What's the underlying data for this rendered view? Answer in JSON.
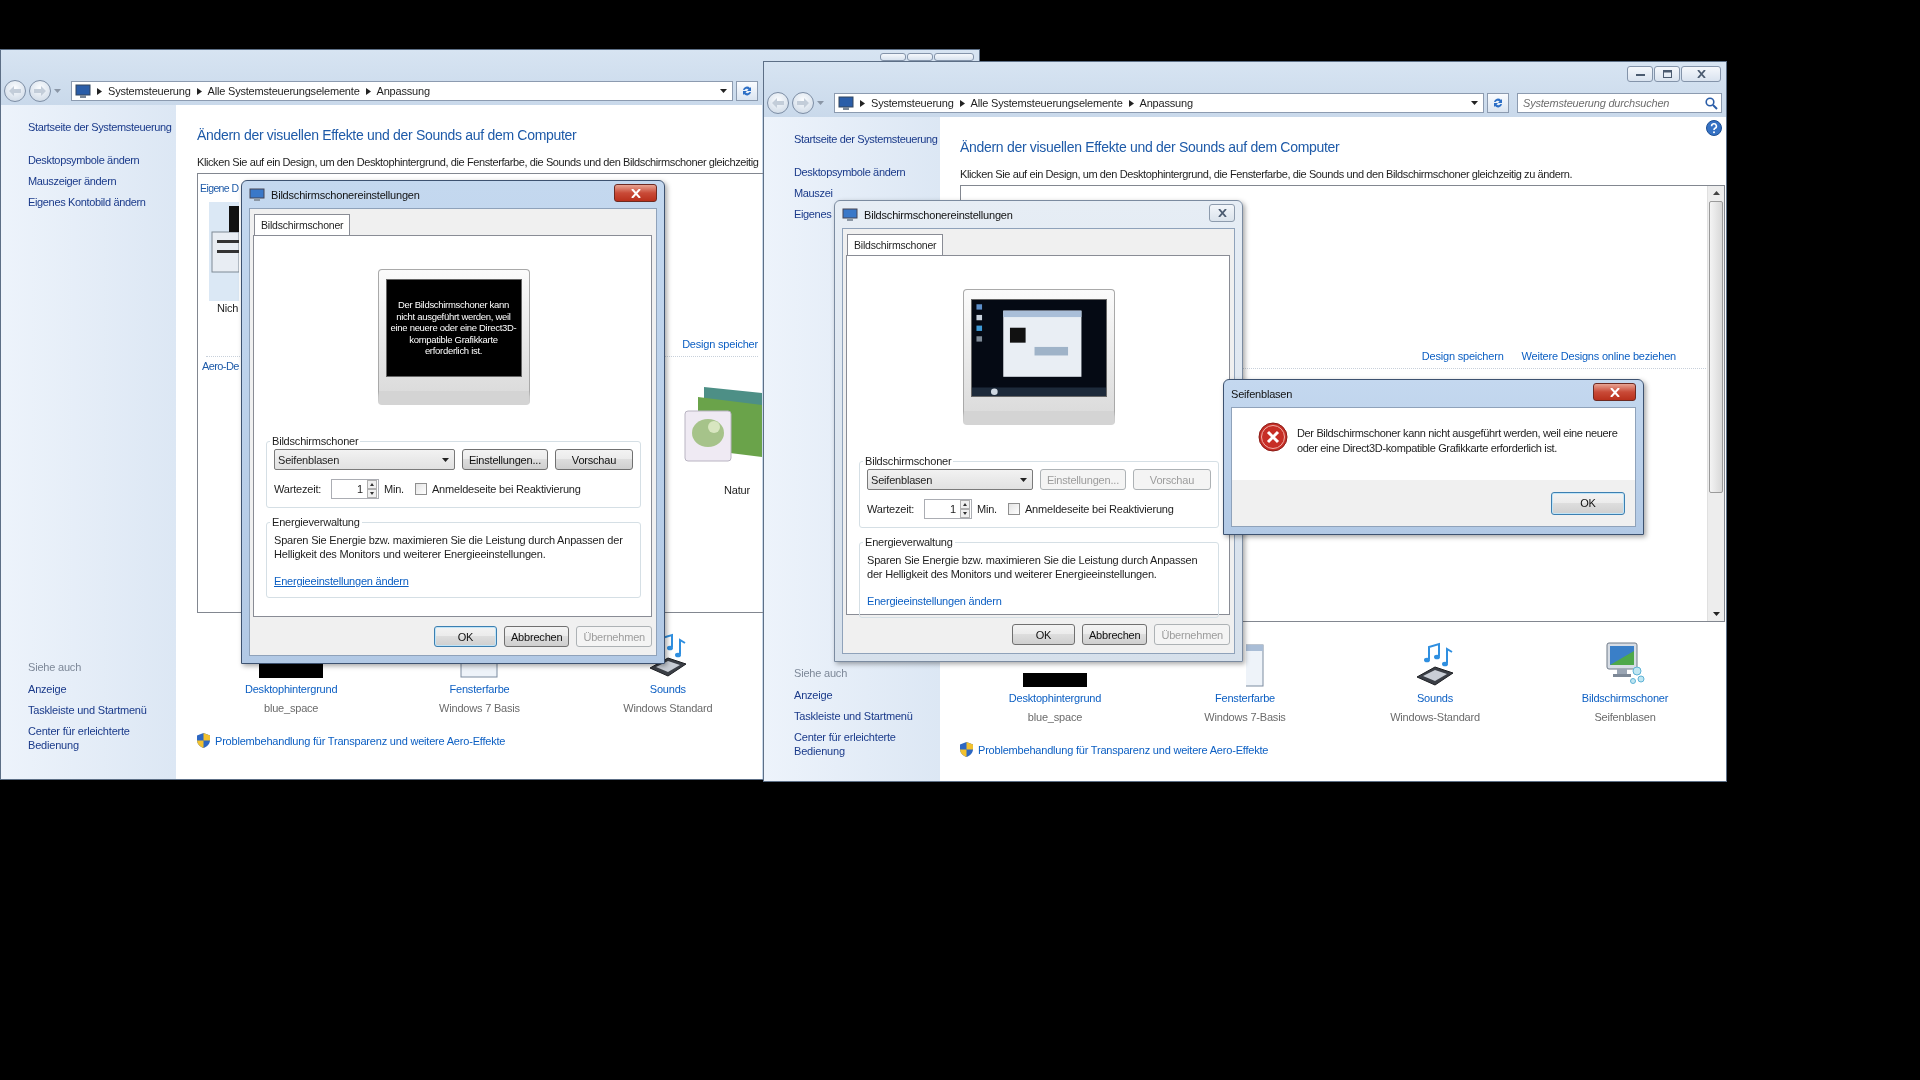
{
  "windows": [
    {
      "kind": "control_panel",
      "breadcrumb": [
        "Systemsteuerung",
        "Alle Systemsteuerungselemente",
        "Anpassung"
      ],
      "sidebar": {
        "links": [
          "Startseite der Systemsteuerung",
          "Desktopsymbole ändern",
          "Mauszeiger ändern",
          "Eigenes Kontobild ändern"
        ],
        "see_also_title": "Siehe auch",
        "see_also": [
          "Anzeige",
          "Taskleiste und Startmenü",
          "Center für erleichterte Bedienung"
        ]
      },
      "heading": "Ändern der visuellen Effekte und der Sounds auf dem Computer",
      "intro": "Klicken Sie auf ein Design, um den Desktophintergrund, die Fensterfarbe, die Sounds und den Bildschirmschoner gleichzeitig",
      "theme_panel": {
        "items": [
          {
            "kind": "group_heading",
            "text": "Eigene D"
          },
          {
            "kind": "basic_theme",
            "text": "Nich"
          },
          {
            "kind": "group_heading",
            "text": "Aero-De"
          },
          {
            "kind": "photo_theme",
            "text": "Natur"
          }
        ],
        "links": [
          "Design speicher"
        ]
      },
      "settings": [
        {
          "kind": "wallpaper",
          "label": "Desktophintergrund",
          "value": "blue_space"
        },
        {
          "kind": "color",
          "label": "Fensterfarbe",
          "value": "Windows 7 Basis"
        },
        {
          "kind": "sounds",
          "label": "Sounds",
          "value": "Windows Standard"
        }
      ],
      "troubleshoot_link": "Problembehandlung für Transparenz und weitere Aero-Effekte"
    },
    {
      "kind": "screensaver_dialog",
      "active": true,
      "title": "Bildschirmschonereinstellungen",
      "tabs": [
        {
          "label": "Bildschirmschoner",
          "selected": true
        }
      ],
      "preview": {
        "kind": "message",
        "text": "Der Bildschirmschoner kann nicht ausgeführt werden, weil eine neuere oder eine Direct3D-kompatible Grafikkarte erforderlich ist."
      },
      "screensaver_group": {
        "title": "Bildschirmschoner",
        "selection": "Seifenblasen",
        "buttons": [
          {
            "label": "Einstellungen...",
            "disabled": false
          },
          {
            "label": "Vorschau",
            "disabled": false
          }
        ],
        "wait_label": "Wartezeit:",
        "wait_value": "1",
        "wait_unit": "Min.",
        "logon_checkbox": {
          "label": "Anmeldeseite bei Reaktivierung",
          "checked": false
        }
      },
      "power_group": {
        "title": "Energieverwaltung",
        "text": "Sparen Sie Energie bzw. maximieren Sie die Leistung durch Anpassen der Helligkeit des Monitors und weiterer Energieeinstellungen.",
        "link": "Energieeinstellungen ändern"
      },
      "buttons": [
        {
          "label": "OK",
          "default": true,
          "disabled": false
        },
        {
          "label": "Abbrechen",
          "default": false,
          "disabled": false
        },
        {
          "label": "Übernehmen",
          "default": false,
          "disabled": true
        }
      ]
    },
    {
      "kind": "control_panel",
      "breadcrumb": [
        "Systemsteuerung",
        "Alle Systemsteuerungselemente",
        "Anpassung"
      ],
      "search": {
        "placeholder": "Systemsteuerung durchsuchen"
      },
      "help_button": true,
      "sidebar": {
        "links": [
          "Startseite der Systemsteuerung",
          "Desktopsymbole ändern",
          "Mauszei",
          "Eigenes"
        ],
        "see_also_title": "Siehe auch",
        "see_also": [
          "Anzeige",
          "Taskleiste und Startmenü",
          "Center für erleichterte Bedienung"
        ]
      },
      "heading": "Ändern der visuellen Effekte und der Sounds auf dem Computer",
      "intro": "Klicken Sie auf ein Design, um den Desktophintergrund, die Fensterfarbe, die Sounds und den Bildschirmschoner gleichzeitig zu ändern.",
      "theme_panel": {
        "links": [
          "Design speichern",
          "Weitere Designs online beziehen"
        ],
        "scrollbar": true
      },
      "settings": [
        {
          "kind": "wallpaper",
          "label": "Desktophintergrund",
          "value": "blue_space"
        },
        {
          "kind": "color",
          "label": "Fensterfarbe",
          "value": "Windows 7-Basis"
        },
        {
          "kind": "sounds",
          "label": "Sounds",
          "value": "Windows-Standard"
        },
        {
          "kind": "screensaver",
          "label": "Bildschirmschoner",
          "value": "Seifenblasen"
        }
      ],
      "troubleshoot_link": "Problembehandlung für Transparenz und weitere Aero-Effekte"
    },
    {
      "kind": "screensaver_dialog",
      "active": false,
      "title": "Bildschirmschonereinstellungen",
      "tabs": [
        {
          "label": "Bildschirmschoner",
          "selected": true
        }
      ],
      "preview": {
        "kind": "picture"
      },
      "screensaver_group": {
        "title": "Bildschirmschoner",
        "selection": "Seifenblasen",
        "buttons": [
          {
            "label": "Einstellungen...",
            "disabled": true
          },
          {
            "label": "Vorschau",
            "disabled": true
          }
        ],
        "wait_label": "Wartezeit:",
        "wait_value": "1",
        "wait_unit": "Min.",
        "logon_checkbox": {
          "label": "Anmeldeseite bei Reaktivierung",
          "checked": false
        }
      },
      "power_group": {
        "title": "Energieverwaltung",
        "text": "Sparen Sie Energie bzw. maximieren Sie die Leistung durch Anpassen der Helligkeit des Monitors und weiterer Energieeinstellungen.",
        "link": "Energieeinstellungen ändern"
      },
      "buttons": [
        {
          "label": "OK",
          "default": false,
          "disabled": false
        },
        {
          "label": "Abbrechen",
          "default": false,
          "disabled": false
        },
        {
          "label": "Übernehmen",
          "default": false,
          "disabled": true
        }
      ]
    },
    {
      "kind": "message_box",
      "active": true,
      "title": "Seifenblasen",
      "message": "Der Bildschirmschoner kann nicht ausgeführt werden, weil eine neuere oder eine Direct3D-kompatible Grafikkarte erforderlich ist.",
      "buttons": [
        {
          "label": "OK",
          "default": true
        }
      ]
    }
  ]
}
